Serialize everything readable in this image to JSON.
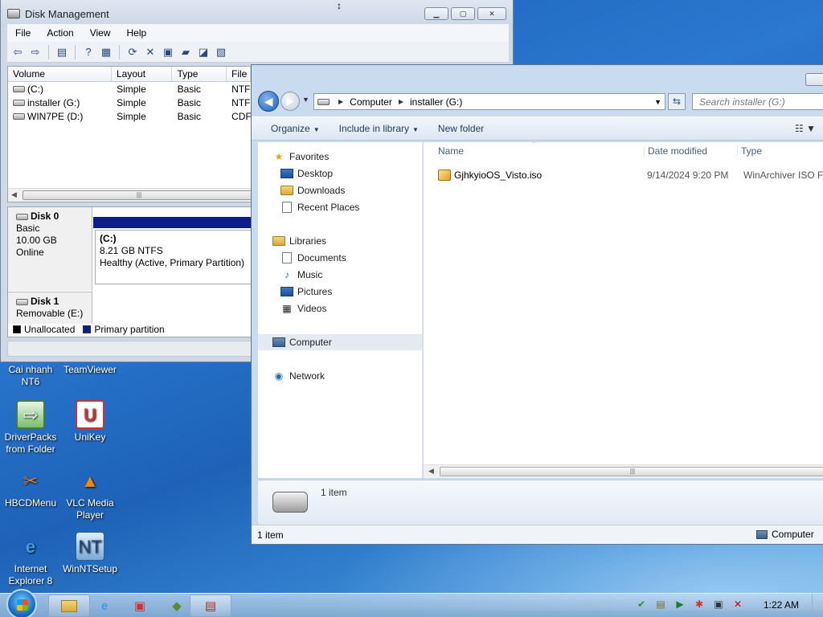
{
  "disk_management": {
    "title": "Disk Management",
    "menu": [
      "File",
      "Action",
      "View",
      "Help"
    ],
    "columns": [
      "Volume",
      "Layout",
      "Type",
      "File"
    ],
    "volumes": [
      {
        "name": "(C:)",
        "layout": "Simple",
        "type": "Basic",
        "fs": "NTF"
      },
      {
        "name": "installer (G:)",
        "layout": "Simple",
        "type": "Basic",
        "fs": "NTF"
      },
      {
        "name": "WIN7PE (D:)",
        "layout": "Simple",
        "type": "Basic",
        "fs": "CDF"
      }
    ],
    "disk0": {
      "name": "Disk 0",
      "kind": "Basic",
      "size": "10.00 GB",
      "state": "Online"
    },
    "partition_c": {
      "name": "(C:)",
      "size": "8.21 GB NTFS",
      "health": "Healthy (Active, Primary Partition)"
    },
    "disk1": {
      "name": "Disk 1",
      "kind": "Removable (E:)"
    },
    "legend": {
      "unallocated": "Unallocated",
      "primary": "Primary partition"
    },
    "colors": {
      "unallocated": "#000000",
      "primary": "#0b1e8c"
    }
  },
  "explorer": {
    "breadcrumb": [
      "Computer",
      "installer (G:)"
    ],
    "search_placeholder": "Search installer (G:)",
    "commands": {
      "organize": "Organize",
      "include": "Include in library",
      "new_folder": "New folder"
    },
    "nav": {
      "favorites": "Favorites",
      "desktop": "Desktop",
      "downloads": "Downloads",
      "recent": "Recent Places",
      "libraries": "Libraries",
      "documents": "Documents",
      "music": "Music",
      "pictures": "Pictures",
      "videos": "Videos",
      "computer": "Computer",
      "network": "Network"
    },
    "columns": {
      "name": "Name",
      "date": "Date modified",
      "type": "Type"
    },
    "files": [
      {
        "name": "GjhkyioOS_Visto.iso",
        "date": "9/14/2024 9:20 PM",
        "type": "WinArchiver ISO F..."
      }
    ],
    "details_count": "1 item",
    "status_left": "1 item",
    "status_right": "Computer"
  },
  "desktop_icons": {
    "cainhanh": "Cai nhanh NT6",
    "teamviewer": "TeamViewer",
    "driverpacks": "DriverPacks from Folder",
    "unikey": "UniKey",
    "hbcd": "HBCDMenu",
    "vlc": "VLC Media Player",
    "ie": "Internet Explorer 8",
    "winnt": "WinNTSetup"
  },
  "taskbar": {
    "clock": "1:22 AM"
  }
}
